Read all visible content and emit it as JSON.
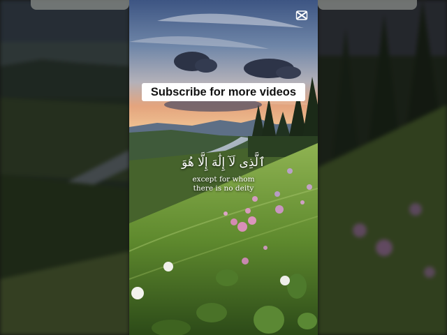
{
  "overlay": {
    "subscribe_text": "Subscribe for more videos",
    "arabic_text": "ٱلَّذِى لَآ إِلَٰهَ إِلَّا هُوَ",
    "translation_line1": "except for whom",
    "translation_line2": "there is no deity"
  },
  "icons": {
    "watermark": "capcut-logo-icon"
  },
  "colors": {
    "subscribe_bg": "#ffffff",
    "subscribe_text": "#111111",
    "caption_text": "#ffffff",
    "sky_top": "#4a5f86",
    "sunset_glow": "#e0a07a",
    "meadow_green": "#7fa046",
    "flower_pink": "#d98fb8"
  }
}
